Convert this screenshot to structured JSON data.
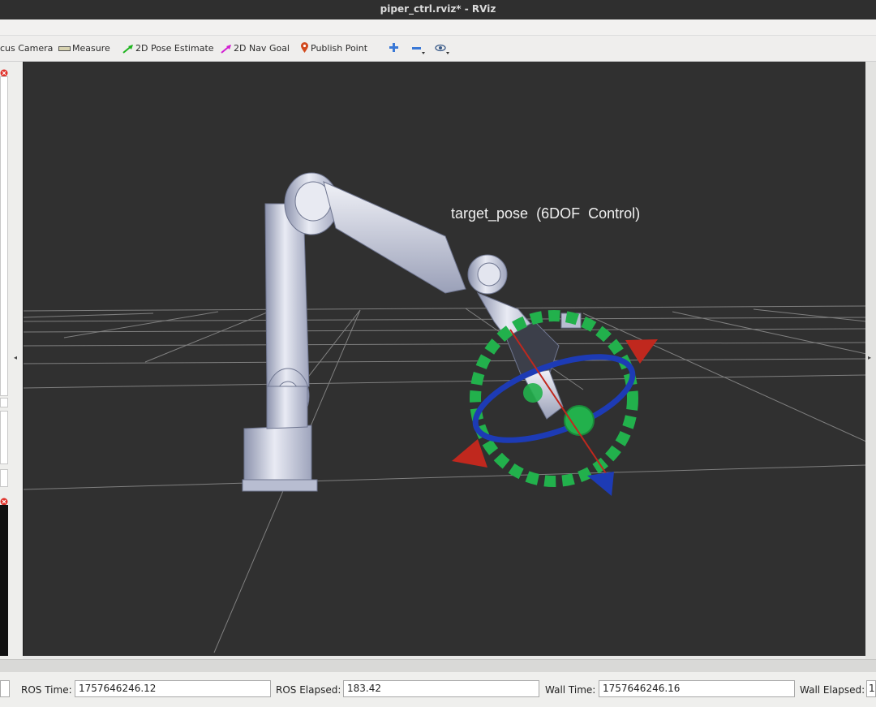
{
  "window": {
    "title": "piper_ctrl.rviz* - RViz"
  },
  "toolbar": {
    "focus_camera": "cus Camera",
    "measure": "Measure",
    "pose_estimate": "2D Pose Estimate",
    "nav_goal": "2D Nav Goal",
    "publish_point": "Publish Point",
    "add_tool_icon": "plus-icon",
    "remove_tool_icon": "minus-icon",
    "views_icon": "eye-icon"
  },
  "viewport": {
    "marker_label": "target_pose  (6DOF  Control)",
    "background_color": "#303030",
    "ring_color": "#22b14c",
    "x_axis_color": "#c0281e",
    "y_axis_color": "#1d3bb5",
    "z_axis_color": "#22b14c"
  },
  "time_panel": {
    "ros_time_label": "ROS Time:",
    "ros_time_value": "1757646246.12",
    "ros_elapsed_label": "ROS Elapsed:",
    "ros_elapsed_value": "183.42",
    "wall_time_label": "Wall Time:",
    "wall_time_value": "1757646246.16",
    "wall_elapsed_label": "Wall Elapsed:",
    "wall_elapsed_value": "1"
  }
}
